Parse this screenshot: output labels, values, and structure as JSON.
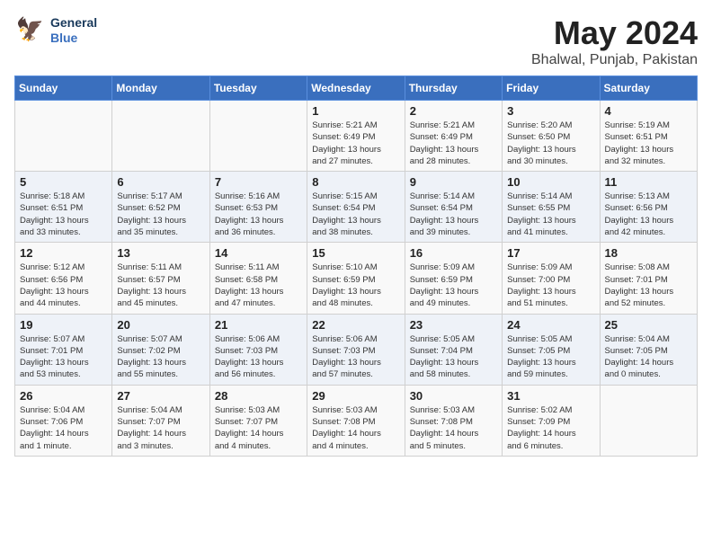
{
  "header": {
    "logo_line1": "General",
    "logo_line2": "Blue",
    "title": "May 2024",
    "subtitle": "Bhalwal, Punjab, Pakistan"
  },
  "days_of_week": [
    "Sunday",
    "Monday",
    "Tuesday",
    "Wednesday",
    "Thursday",
    "Friday",
    "Saturday"
  ],
  "weeks": [
    [
      {
        "day": "",
        "info": ""
      },
      {
        "day": "",
        "info": ""
      },
      {
        "day": "",
        "info": ""
      },
      {
        "day": "1",
        "info": "Sunrise: 5:21 AM\nSunset: 6:49 PM\nDaylight: 13 hours\nand 27 minutes."
      },
      {
        "day": "2",
        "info": "Sunrise: 5:21 AM\nSunset: 6:49 PM\nDaylight: 13 hours\nand 28 minutes."
      },
      {
        "day": "3",
        "info": "Sunrise: 5:20 AM\nSunset: 6:50 PM\nDaylight: 13 hours\nand 30 minutes."
      },
      {
        "day": "4",
        "info": "Sunrise: 5:19 AM\nSunset: 6:51 PM\nDaylight: 13 hours\nand 32 minutes."
      }
    ],
    [
      {
        "day": "5",
        "info": "Sunrise: 5:18 AM\nSunset: 6:51 PM\nDaylight: 13 hours\nand 33 minutes."
      },
      {
        "day": "6",
        "info": "Sunrise: 5:17 AM\nSunset: 6:52 PM\nDaylight: 13 hours\nand 35 minutes."
      },
      {
        "day": "7",
        "info": "Sunrise: 5:16 AM\nSunset: 6:53 PM\nDaylight: 13 hours\nand 36 minutes."
      },
      {
        "day": "8",
        "info": "Sunrise: 5:15 AM\nSunset: 6:54 PM\nDaylight: 13 hours\nand 38 minutes."
      },
      {
        "day": "9",
        "info": "Sunrise: 5:14 AM\nSunset: 6:54 PM\nDaylight: 13 hours\nand 39 minutes."
      },
      {
        "day": "10",
        "info": "Sunrise: 5:14 AM\nSunset: 6:55 PM\nDaylight: 13 hours\nand 41 minutes."
      },
      {
        "day": "11",
        "info": "Sunrise: 5:13 AM\nSunset: 6:56 PM\nDaylight: 13 hours\nand 42 minutes."
      }
    ],
    [
      {
        "day": "12",
        "info": "Sunrise: 5:12 AM\nSunset: 6:56 PM\nDaylight: 13 hours\nand 44 minutes."
      },
      {
        "day": "13",
        "info": "Sunrise: 5:11 AM\nSunset: 6:57 PM\nDaylight: 13 hours\nand 45 minutes."
      },
      {
        "day": "14",
        "info": "Sunrise: 5:11 AM\nSunset: 6:58 PM\nDaylight: 13 hours\nand 47 minutes."
      },
      {
        "day": "15",
        "info": "Sunrise: 5:10 AM\nSunset: 6:59 PM\nDaylight: 13 hours\nand 48 minutes."
      },
      {
        "day": "16",
        "info": "Sunrise: 5:09 AM\nSunset: 6:59 PM\nDaylight: 13 hours\nand 49 minutes."
      },
      {
        "day": "17",
        "info": "Sunrise: 5:09 AM\nSunset: 7:00 PM\nDaylight: 13 hours\nand 51 minutes."
      },
      {
        "day": "18",
        "info": "Sunrise: 5:08 AM\nSunset: 7:01 PM\nDaylight: 13 hours\nand 52 minutes."
      }
    ],
    [
      {
        "day": "19",
        "info": "Sunrise: 5:07 AM\nSunset: 7:01 PM\nDaylight: 13 hours\nand 53 minutes."
      },
      {
        "day": "20",
        "info": "Sunrise: 5:07 AM\nSunset: 7:02 PM\nDaylight: 13 hours\nand 55 minutes."
      },
      {
        "day": "21",
        "info": "Sunrise: 5:06 AM\nSunset: 7:03 PM\nDaylight: 13 hours\nand 56 minutes."
      },
      {
        "day": "22",
        "info": "Sunrise: 5:06 AM\nSunset: 7:03 PM\nDaylight: 13 hours\nand 57 minutes."
      },
      {
        "day": "23",
        "info": "Sunrise: 5:05 AM\nSunset: 7:04 PM\nDaylight: 13 hours\nand 58 minutes."
      },
      {
        "day": "24",
        "info": "Sunrise: 5:05 AM\nSunset: 7:05 PM\nDaylight: 13 hours\nand 59 minutes."
      },
      {
        "day": "25",
        "info": "Sunrise: 5:04 AM\nSunset: 7:05 PM\nDaylight: 14 hours\nand 0 minutes."
      }
    ],
    [
      {
        "day": "26",
        "info": "Sunrise: 5:04 AM\nSunset: 7:06 PM\nDaylight: 14 hours\nand 1 minute."
      },
      {
        "day": "27",
        "info": "Sunrise: 5:04 AM\nSunset: 7:07 PM\nDaylight: 14 hours\nand 3 minutes."
      },
      {
        "day": "28",
        "info": "Sunrise: 5:03 AM\nSunset: 7:07 PM\nDaylight: 14 hours\nand 4 minutes."
      },
      {
        "day": "29",
        "info": "Sunrise: 5:03 AM\nSunset: 7:08 PM\nDaylight: 14 hours\nand 4 minutes."
      },
      {
        "day": "30",
        "info": "Sunrise: 5:03 AM\nSunset: 7:08 PM\nDaylight: 14 hours\nand 5 minutes."
      },
      {
        "day": "31",
        "info": "Sunrise: 5:02 AM\nSunset: 7:09 PM\nDaylight: 14 hours\nand 6 minutes."
      },
      {
        "day": "",
        "info": ""
      }
    ]
  ]
}
